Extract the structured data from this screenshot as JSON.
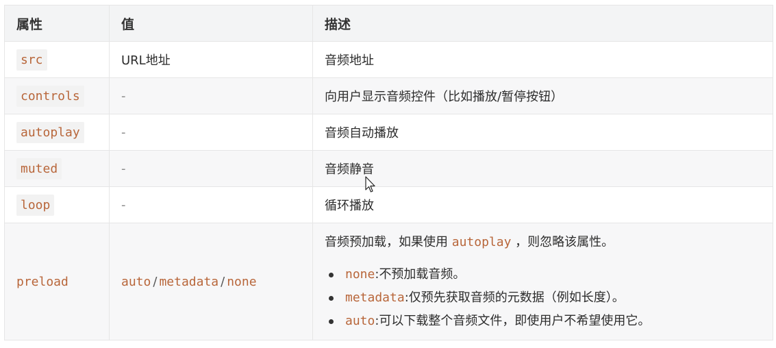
{
  "table": {
    "headers": [
      "属性",
      "值",
      "描述"
    ],
    "rows": [
      {
        "attr": "src",
        "value": "URL地址",
        "desc": "音频地址"
      },
      {
        "attr": "controls",
        "value": "-",
        "desc": "向用户显示音频控件（比如播放/暂停按钮）"
      },
      {
        "attr": "autoplay",
        "value": "-",
        "desc": "音频自动播放"
      },
      {
        "attr": "muted",
        "value": "-",
        "desc": "音频静音"
      },
      {
        "attr": "loop",
        "value": "-",
        "desc": "循环播放"
      }
    ],
    "preload": {
      "attr": "preload",
      "values": [
        "auto",
        "metadata",
        "none"
      ],
      "value_sep": "/",
      "desc_prefix": "音频预加载，如果使用",
      "desc_code": "autoplay",
      "desc_suffix": "，则忽略该属性。",
      "options": [
        {
          "code": "none",
          "text": "不预加载音频。"
        },
        {
          "code": "metadata",
          "text": "仅预先获取音频的元数据（例如长度）。"
        },
        {
          "code": "auto",
          "text": "可以下载整个音频文件，即使用户不希望使用它。"
        }
      ],
      "option_colon": ":"
    }
  }
}
